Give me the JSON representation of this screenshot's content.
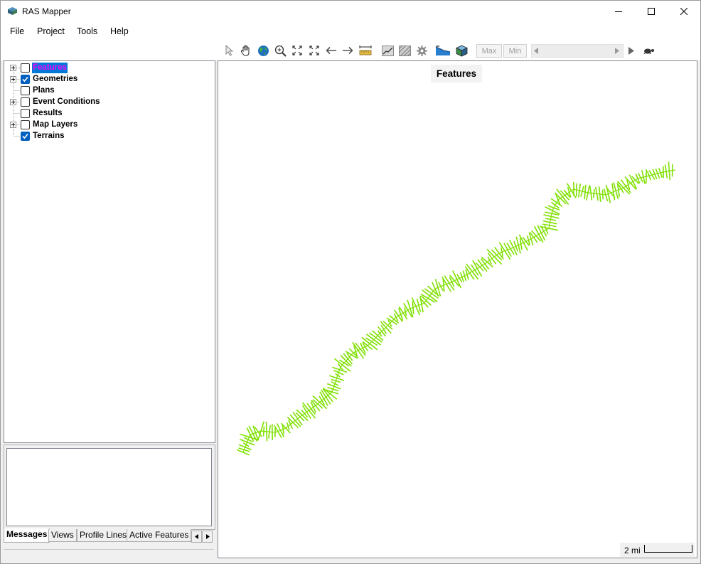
{
  "window": {
    "title": "RAS Mapper"
  },
  "menu": {
    "items": [
      "File",
      "Project",
      "Tools",
      "Help"
    ]
  },
  "toolbar": {
    "max_label": "Max",
    "min_label": "Min"
  },
  "tree": {
    "items": [
      {
        "label": "Features",
        "checked": false,
        "expandable": true,
        "selected": true
      },
      {
        "label": "Geometries",
        "checked": true,
        "expandable": true,
        "selected": false
      },
      {
        "label": "Plans",
        "checked": false,
        "expandable": false,
        "selected": false
      },
      {
        "label": "Event Conditions",
        "checked": false,
        "expandable": true,
        "selected": false
      },
      {
        "label": "Results",
        "checked": false,
        "expandable": false,
        "selected": false
      },
      {
        "label": "Map Layers",
        "checked": false,
        "expandable": true,
        "selected": false
      },
      {
        "label": "Terrains",
        "checked": true,
        "expandable": false,
        "selected": false
      }
    ]
  },
  "bottom_tabs": {
    "items": [
      "Messages",
      "Views",
      "Profile Lines",
      "Active Features"
    ],
    "active": "Messages"
  },
  "map": {
    "title": "Features",
    "scale_label": "2 mi",
    "feature_color": "#7fe000"
  },
  "colors": {
    "selection_bg": "#0078d7",
    "selection_text": "#ff00ff",
    "checkbox_checked": "#0060c0"
  }
}
